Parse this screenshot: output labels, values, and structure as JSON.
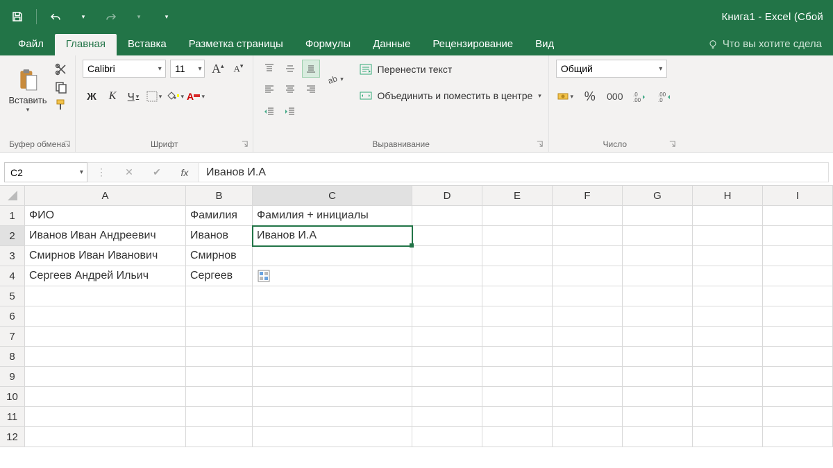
{
  "titlebar": {
    "title": "Книга1 - Excel (Сбой "
  },
  "tabs": {
    "file": "Файл",
    "home": "Главная",
    "insert": "Вставка",
    "pagelayout": "Разметка страницы",
    "formulas": "Формулы",
    "data": "Данные",
    "review": "Рецензирование",
    "view": "Вид",
    "tellme": "Что вы хотите сдела"
  },
  "ribbon": {
    "clipboard": {
      "paste": "Вставить",
      "title": "Буфер обмена"
    },
    "font": {
      "name": "Calibri",
      "size": "11",
      "bold": "Ж",
      "italic": "К",
      "underline": "Ч",
      "fontcolor_letter": "А",
      "title": "Шрифт"
    },
    "alignment": {
      "wrap": "Перенести текст",
      "merge": "Объединить и поместить в центре",
      "title": "Выравнивание"
    },
    "number": {
      "format": "Общий",
      "percent": "%",
      "thousands": "000",
      "title": "Число"
    }
  },
  "fxbar": {
    "cellref": "C2",
    "fx_label": "fx",
    "formula": "Иванов И.А"
  },
  "grid": {
    "columns": [
      "A",
      "B",
      "C",
      "D",
      "E",
      "F",
      "G",
      "H",
      "I"
    ],
    "rows": [
      {
        "n": "1",
        "A": "ФИО",
        "B": "Фамилия",
        "C": "Фамилия + инициалы"
      },
      {
        "n": "2",
        "A": "Иванов Иван Андреевич",
        "B": "Иванов",
        "C": "Иванов И.А"
      },
      {
        "n": "3",
        "A": "Смирнов Иван Иванович",
        "B": "Смирнов",
        "C": ""
      },
      {
        "n": "4",
        "A": "Сергеев Андрей Ильич",
        "B": "Сергеев",
        "C": ""
      },
      {
        "n": "5"
      },
      {
        "n": "6"
      },
      {
        "n": "7"
      },
      {
        "n": "8"
      },
      {
        "n": "9"
      },
      {
        "n": "10"
      },
      {
        "n": "11"
      },
      {
        "n": "12"
      }
    ],
    "active_cell": "C2",
    "selected_col": "C",
    "selected_row": "2"
  }
}
